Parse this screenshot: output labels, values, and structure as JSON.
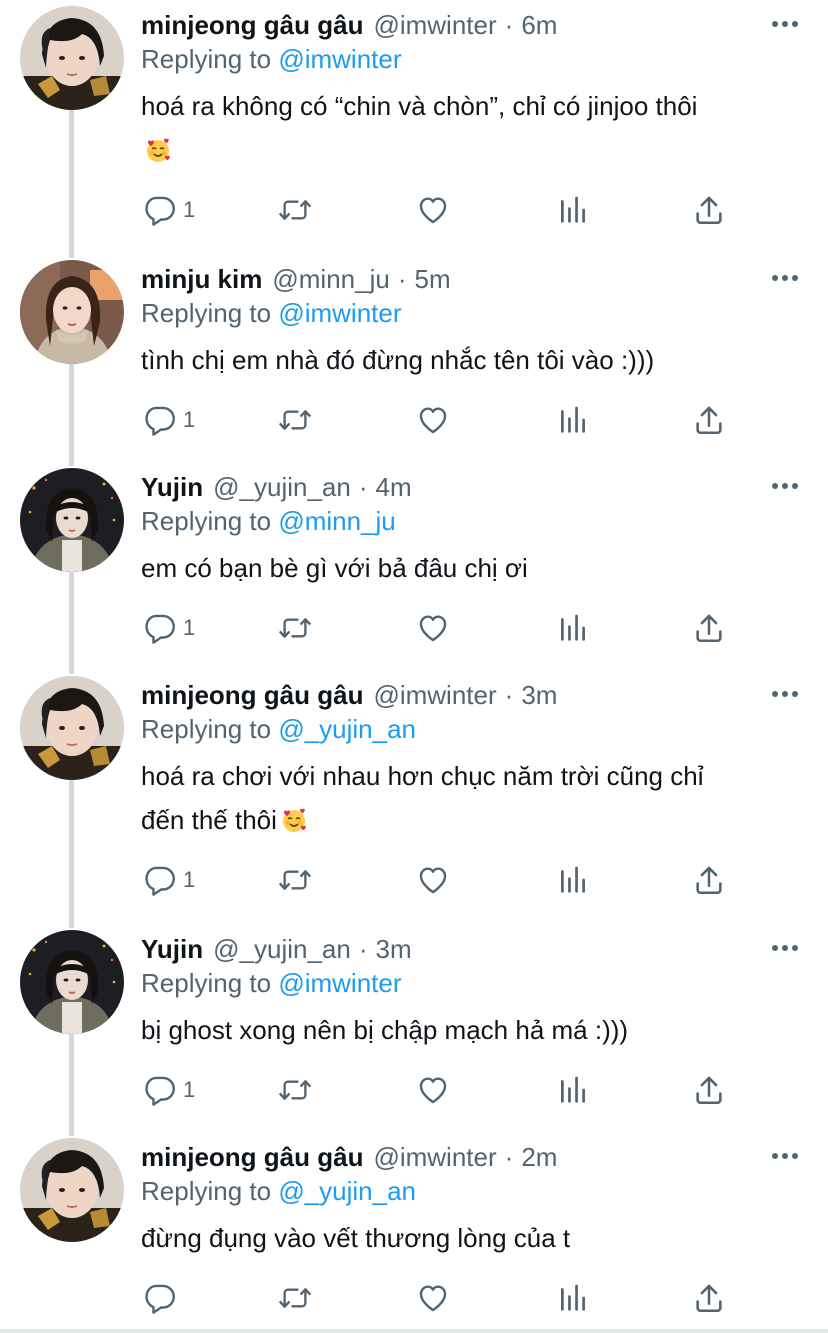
{
  "tweets": [
    {
      "name": "minjeong gâu gâu",
      "handle": "@imwinter",
      "time": "6m",
      "replying_prefix": "Replying to",
      "replying_to": "@imwinter",
      "lines": [
        "hoá ra không có “chin và chòn”, chỉ có jinjoo thôi",
        ""
      ],
      "emoji_line": 1,
      "reply_count": "1"
    },
    {
      "name": "minju kim",
      "handle": "@minn_ju",
      "time": "5m",
      "replying_prefix": "Replying to",
      "replying_to": "@imwinter",
      "lines": [
        "tình chị em nhà đó đừng nhắc tên tôi vào :)))"
      ],
      "reply_count": "1"
    },
    {
      "name": "Yujin",
      "handle": "@_yujin_an",
      "time": "4m",
      "replying_prefix": "Replying to",
      "replying_to": "@minn_ju",
      "lines": [
        "em có bạn bè gì với bả đâu chị ơi"
      ],
      "reply_count": "1"
    },
    {
      "name": "minjeong gâu gâu",
      "handle": "@imwinter",
      "time": "3m",
      "replying_prefix": "Replying to",
      "replying_to": "@_yujin_an",
      "lines": [
        "hoá ra chơi với nhau hơn chục năm trời cũng chỉ",
        "đến thế thôi"
      ],
      "emoji_line": 1,
      "reply_count": "1"
    },
    {
      "name": "Yujin",
      "handle": "@_yujin_an",
      "time": "3m",
      "replying_prefix": "Replying to",
      "replying_to": "@imwinter",
      "lines": [
        "bị ghost xong nên bị chập mạch hả má :)))"
      ],
      "reply_count": "1"
    },
    {
      "name": "minjeong gâu gâu",
      "handle": "@imwinter",
      "time": "2m",
      "replying_prefix": "Replying to",
      "replying_to": "@_yujin_an",
      "lines": [
        "đừng đụng vào vết thương lòng của t"
      ],
      "reply_count": ""
    }
  ],
  "icons": {
    "reply": "reply-icon",
    "retweet": "retweet-icon",
    "like": "heart-icon",
    "analytics": "analytics-icon",
    "share": "share-icon",
    "more": "more-icon",
    "emoji": "smiling-face-with-hearts-icon"
  },
  "colors": {
    "link": "#1d9bf0",
    "secondary_text": "#536471",
    "primary_text": "#0f1419",
    "thread_line": "#cfd9de"
  }
}
